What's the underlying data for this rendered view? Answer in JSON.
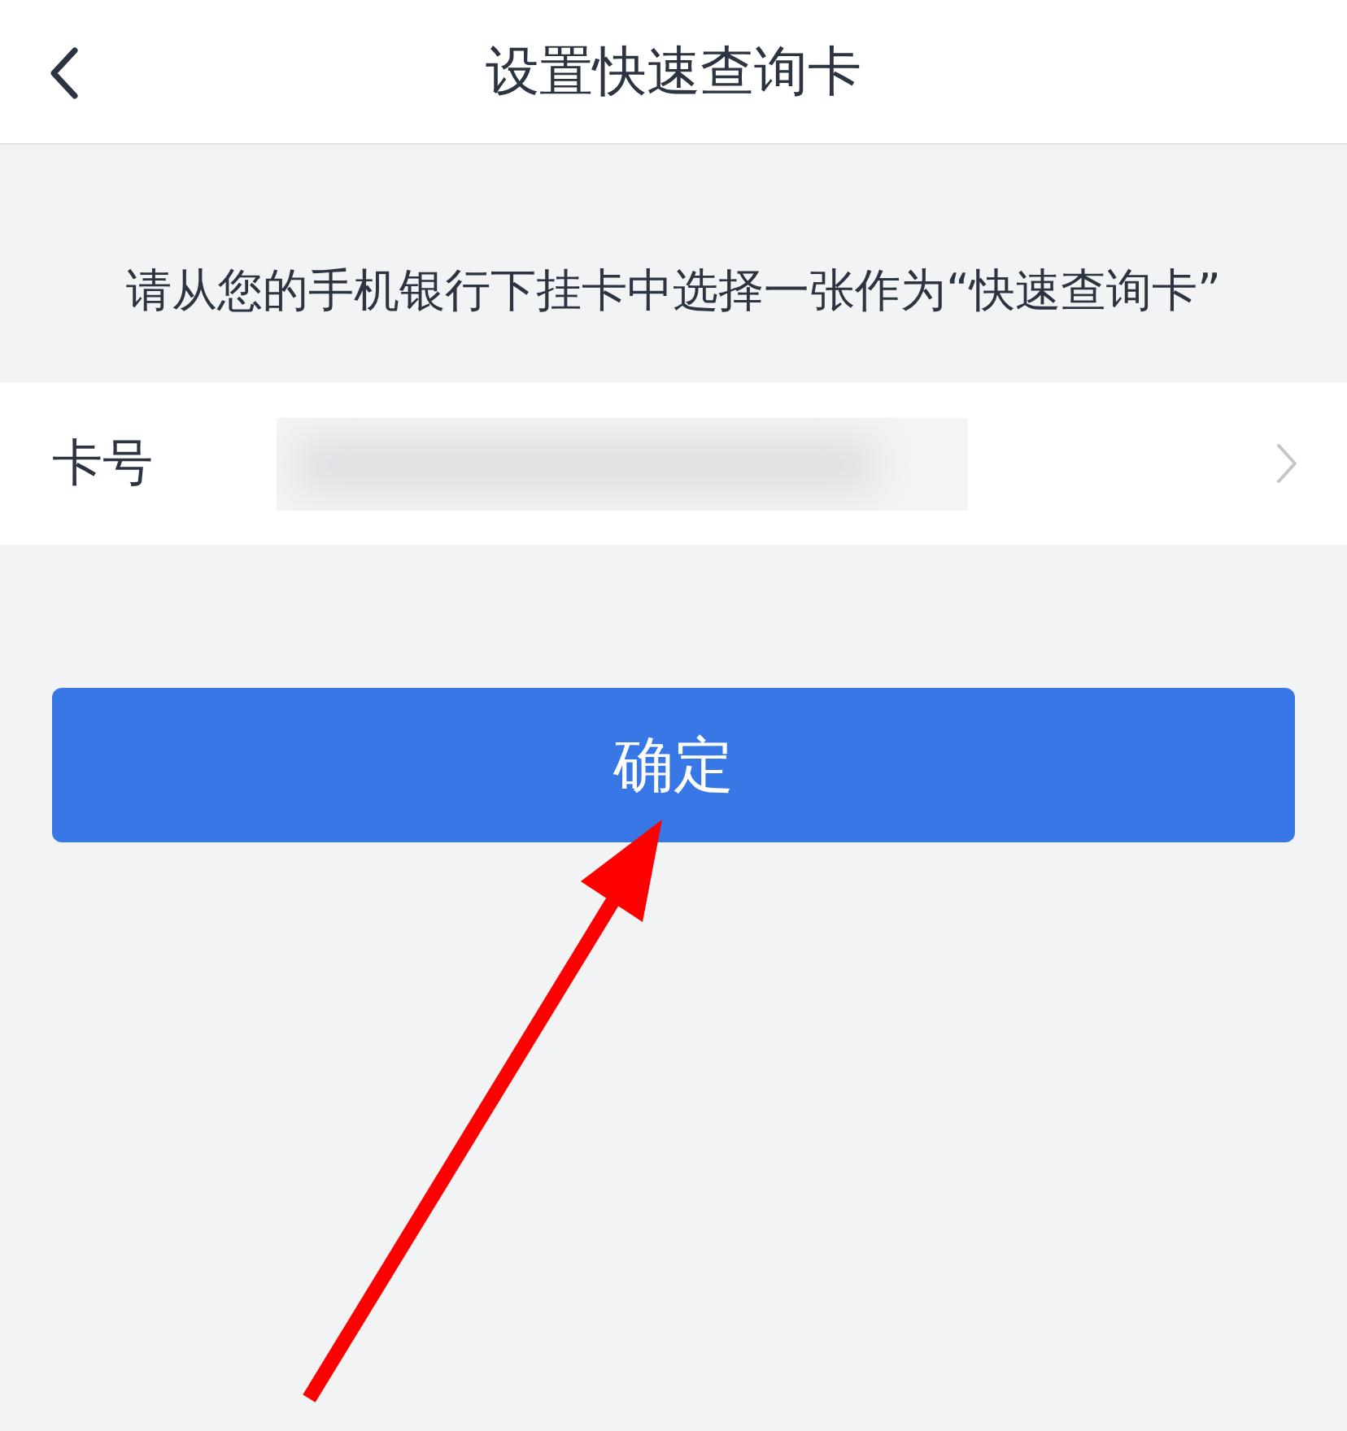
{
  "header": {
    "title": "设置快速查询卡",
    "back_button": true
  },
  "instruction": "请从您的手机银行下挂卡中选择一张作为“快速查询卡”",
  "card_row": {
    "label": "卡号",
    "value_obscured": true,
    "chevron": true
  },
  "confirm_button": {
    "label": "确定"
  },
  "annotation": {
    "kind": "arrow"
  }
}
